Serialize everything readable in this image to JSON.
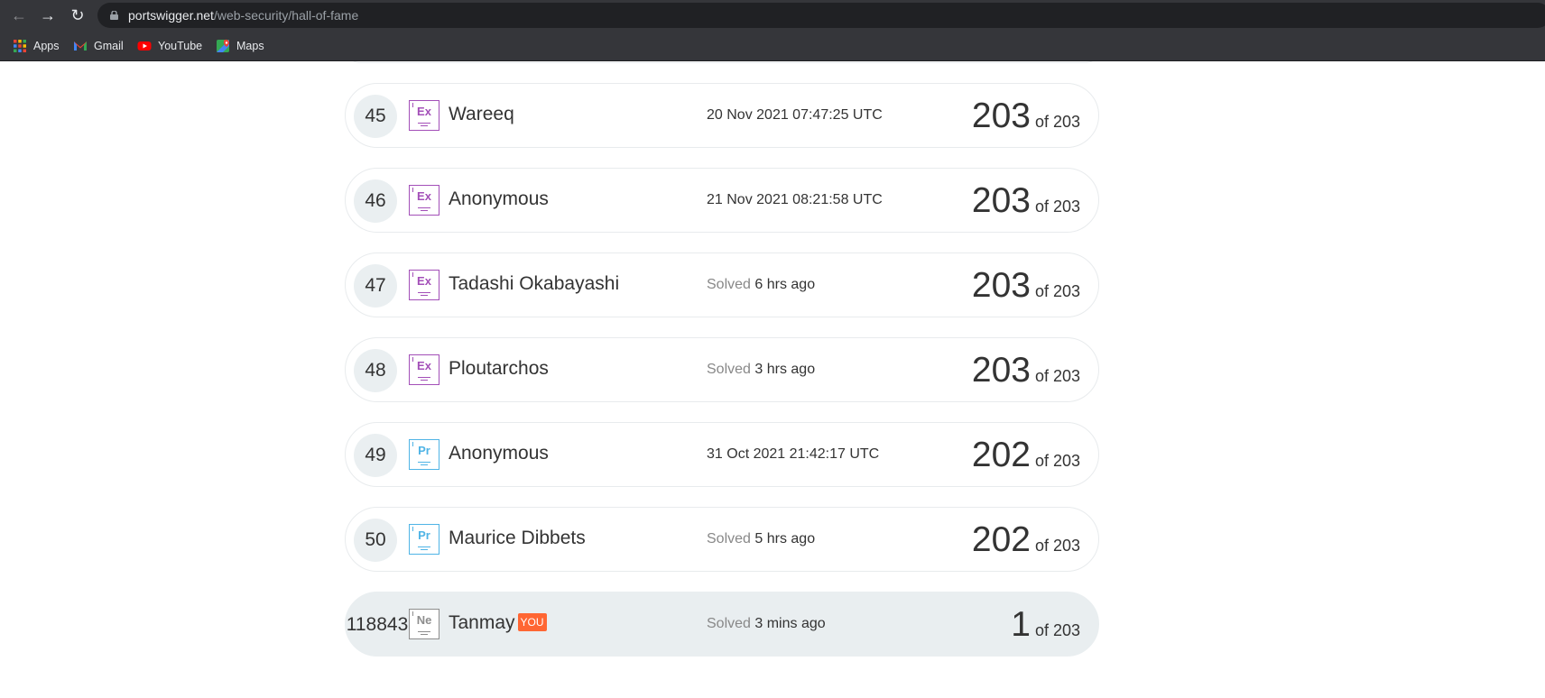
{
  "browser": {
    "url_domain": "portswigger.net",
    "url_path": "/web-security/hall-of-fame",
    "bookmarks": [
      "Apps",
      "Gmail",
      "YouTube",
      "Maps"
    ]
  },
  "leaderboard": {
    "rows": [
      {
        "rank": "45",
        "badge": "Ex",
        "name": "Wareeq",
        "time_prefix": "",
        "time": "20 Nov 2021 07:47:25 UTC",
        "score": "203",
        "of": "of 203"
      },
      {
        "rank": "46",
        "badge": "Ex",
        "name": "Anonymous",
        "time_prefix": "",
        "time": "21 Nov 2021 08:21:58 UTC",
        "score": "203",
        "of": "of 203"
      },
      {
        "rank": "47",
        "badge": "Ex",
        "name": "Tadashi Okabayashi",
        "time_prefix": "Solved",
        "time": "6 hrs ago",
        "score": "203",
        "of": "of 203"
      },
      {
        "rank": "48",
        "badge": "Ex",
        "name": "Ploutarchos",
        "time_prefix": "Solved",
        "time": "3 hrs ago",
        "score": "203",
        "of": "of 203"
      },
      {
        "rank": "49",
        "badge": "Pr",
        "name": "Anonymous",
        "time_prefix": "",
        "time": "31 Oct 2021 21:42:17 UTC",
        "score": "202",
        "of": "of 203"
      },
      {
        "rank": "50",
        "badge": "Pr",
        "name": "Maurice Dibbets",
        "time_prefix": "Solved",
        "time": "5 hrs ago",
        "score": "202",
        "of": "of 203"
      }
    ],
    "current_user": {
      "rank": "118843",
      "badge": "Ne",
      "name": "Tanmay",
      "you_label": "YOU",
      "time_prefix": "Solved",
      "time": "3 mins ago",
      "score": "1",
      "of": "of 203"
    }
  },
  "colors": {
    "expert": "#a34fb8",
    "practitioner": "#4fb4e6",
    "newbie": "#8d8d8d",
    "you_tag": "#ff6633"
  }
}
